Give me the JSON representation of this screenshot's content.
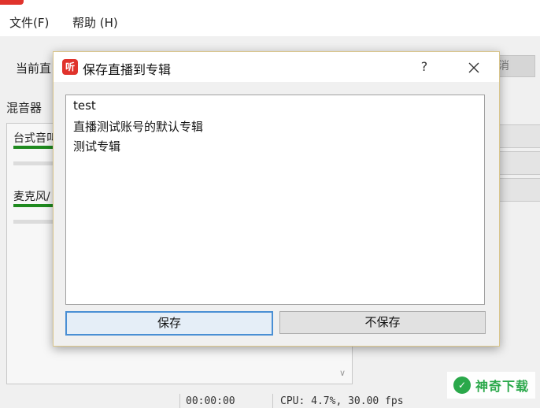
{
  "menubar": {
    "items": [
      "文件(F)",
      "帮助 (H)"
    ]
  },
  "main": {
    "current_label": "当前直",
    "top_right_button": "消",
    "mixer_label": "混音器",
    "mixer_channels": [
      {
        "label": "台式音叫"
      },
      {
        "label": "麦克风/"
      }
    ]
  },
  "statusbar": {
    "time": "00:00:00",
    "cpu": "CPU: 4.7%, 30.00 fps"
  },
  "watermark": {
    "text": "神奇下载"
  },
  "dialog": {
    "icon_text": "听",
    "title": "保存直播到专辑",
    "help_label": "?",
    "albums": [
      "test",
      "直播测试账号的默认专辑",
      "测试专辑"
    ],
    "save_label": "保存",
    "nosave_label": "不保存"
  },
  "colors": {
    "brand_red": "#e0332c",
    "focus_blue": "#4a8fd4",
    "meter_green": "#1f8a1f",
    "watermark_green": "#2aa84a"
  }
}
